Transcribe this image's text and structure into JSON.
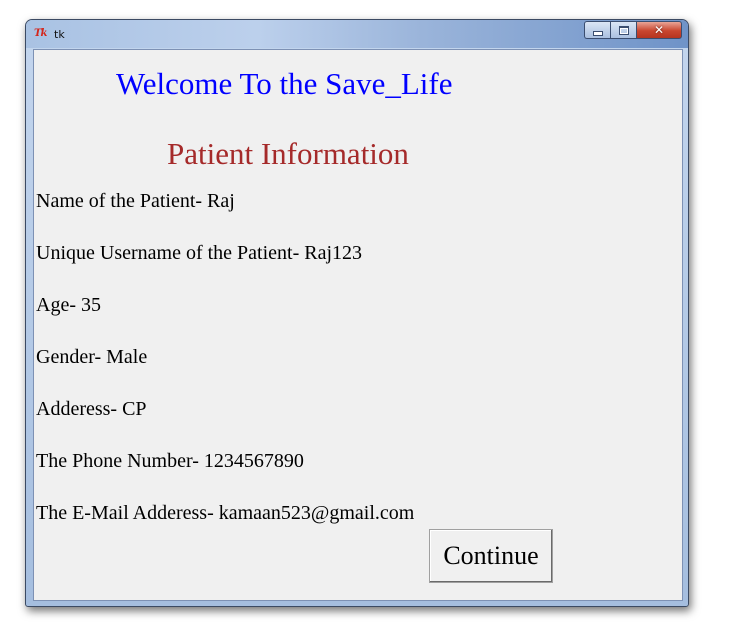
{
  "window": {
    "app_icon_text": "Tk",
    "title": "tk",
    "close_glyph": "✕",
    "close_color": "#c9462f"
  },
  "content": {
    "welcome": "Welcome To the Save_Life",
    "welcome_color": "#0000ff",
    "subtitle": "Patient Information",
    "subtitle_color": "#a52a2a",
    "fields": [
      "Name of the Patient- Raj",
      "Unique Username of the Patient- Raj123",
      "Age- 35",
      "Gender- Male",
      "Adderess- CP",
      "The Phone Number- 1234567890",
      "The E-Mail Adderess- kamaan523@gmail.com"
    ],
    "continue_label": "Continue"
  }
}
